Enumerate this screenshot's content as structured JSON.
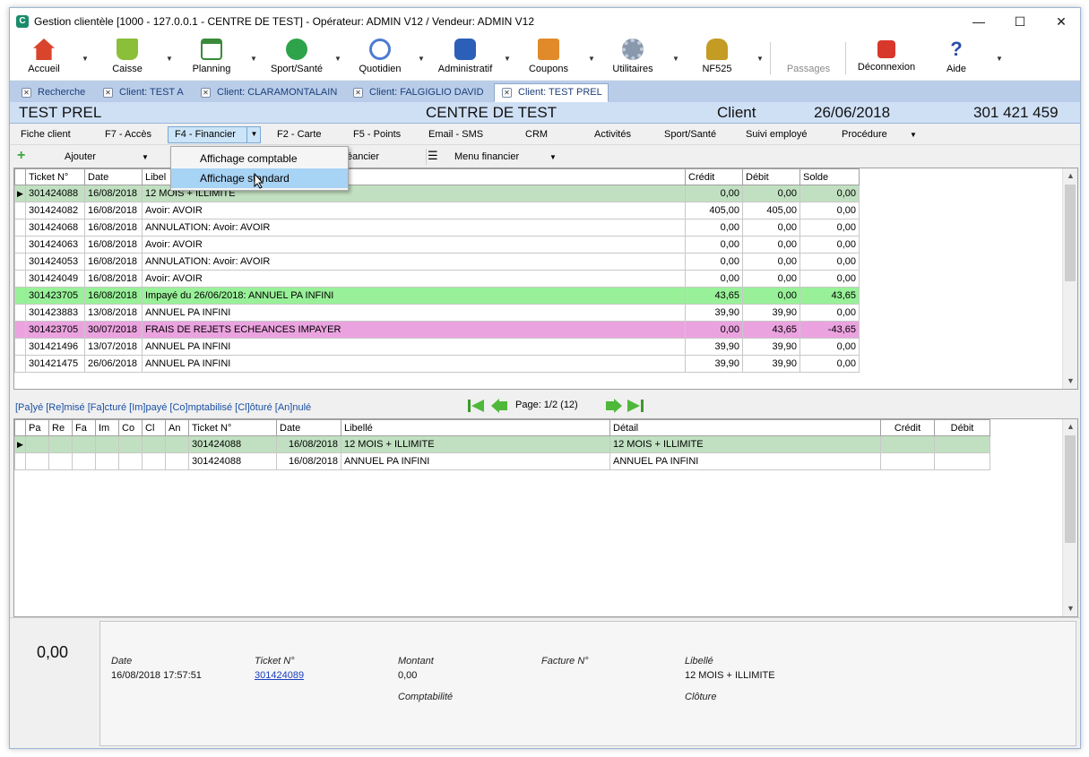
{
  "window": {
    "title": "Gestion clientèle [1000 - 127.0.0.1 - CENTRE DE TEST] - Opérateur: ADMIN V12 / Vendeur: ADMIN V12",
    "app_icon_letter": "C",
    "controls": {
      "minimize": "—",
      "maximize": "☐",
      "close": "✕"
    }
  },
  "toolbar": [
    {
      "label": "Accueil",
      "icon": "home-icon",
      "color": "#d9452c"
    },
    {
      "label": "Caisse",
      "icon": "cart-icon",
      "color": "#8bbf3a"
    },
    {
      "label": "Planning",
      "icon": "calendar-icon",
      "color": "#3a8a3a"
    },
    {
      "label": "Sport/Santé",
      "icon": "runner-icon",
      "color": "#2ea34a"
    },
    {
      "label": "Quotidien",
      "icon": "clock-icon",
      "color": "#4d7bd1"
    },
    {
      "label": "Administratif",
      "icon": "euro-icon",
      "color": "#2b5fb8"
    },
    {
      "label": "Coupons",
      "icon": "coupon-icon",
      "color": "#e08a2a"
    },
    {
      "label": "Utilitaires",
      "icon": "gear-icon",
      "color": "#8a98ad"
    },
    {
      "label": "NF525",
      "icon": "lock-icon",
      "color": "#c49b23"
    },
    {
      "label": "Passages",
      "icon": "",
      "color": ""
    },
    {
      "label": "Déconnexion",
      "icon": "power-icon",
      "color": "#d8382c"
    },
    {
      "label": "Aide",
      "icon": "help-icon",
      "color": "#2b4fa8"
    }
  ],
  "doc_tabs": [
    {
      "label": "Recherche"
    },
    {
      "label": "Client: TEST A"
    },
    {
      "label": "Client: CLARAMONTALAIN"
    },
    {
      "label": "Client: FALGIGLIO DAVID"
    },
    {
      "label": "Client: TEST PREL"
    }
  ],
  "client_header": {
    "name": "TEST PREL",
    "centre": "CENTRE DE TEST",
    "type": "Client",
    "date": "26/06/2018",
    "number": "301 421 459"
  },
  "subnav": [
    "Fiche client",
    "F7 - Accès",
    "F4 - Financier",
    "F2 - Carte",
    "F5 - Points",
    "Email - SMS",
    "CRM",
    "Activités",
    "Sport/Santé",
    "Suivi employé",
    "Procédure"
  ],
  "actions": {
    "add": "Ajouter",
    "echeancier": "éancier",
    "menu": "Menu financier"
  },
  "dropdown": {
    "items": [
      "Affichage comptable",
      "Affichage standard"
    ]
  },
  "grid1": {
    "columns": [
      "Ticket N°",
      "Date",
      "Libel",
      "Crédit",
      "Débit",
      "Solde"
    ],
    "rows": [
      {
        "ticket": "301424088",
        "date": "16/08/2018",
        "libelle": "12 MOIS + ILLIMITE",
        "credit": "0,00",
        "debit": "0,00",
        "solde": "0,00",
        "style": "green-sel",
        "ind": "▶"
      },
      {
        "ticket": "301424082",
        "date": "16/08/2018",
        "libelle": "Avoir: AVOIR",
        "credit": "405,00",
        "debit": "405,00",
        "solde": "0,00",
        "style": "",
        "ind": ""
      },
      {
        "ticket": "301424068",
        "date": "16/08/2018",
        "libelle": "ANNULATION: Avoir: AVOIR",
        "credit": "0,00",
        "debit": "0,00",
        "solde": "0,00",
        "style": "",
        "ind": ""
      },
      {
        "ticket": "301424063",
        "date": "16/08/2018",
        "libelle": "Avoir: AVOIR",
        "credit": "0,00",
        "debit": "0,00",
        "solde": "0,00",
        "style": "",
        "ind": ""
      },
      {
        "ticket": "301424053",
        "date": "16/08/2018",
        "libelle": "ANNULATION: Avoir: AVOIR",
        "credit": "0,00",
        "debit": "0,00",
        "solde": "0,00",
        "style": "",
        "ind": ""
      },
      {
        "ticket": "301424049",
        "date": "16/08/2018",
        "libelle": "Avoir: AVOIR",
        "credit": "0,00",
        "debit": "0,00",
        "solde": "0,00",
        "style": "",
        "ind": ""
      },
      {
        "ticket": "301423705",
        "date": "16/08/2018",
        "libelle": "Impayé du 26/06/2018: ANNUEL PA INFINI",
        "credit": "43,65",
        "debit": "0,00",
        "solde": "43,65",
        "style": "green",
        "ind": ""
      },
      {
        "ticket": "301423883",
        "date": "13/08/2018",
        "libelle": "ANNUEL PA INFINI",
        "credit": "39,90",
        "debit": "39,90",
        "solde": "0,00",
        "style": "",
        "ind": ""
      },
      {
        "ticket": "301423705",
        "date": "30/07/2018",
        "libelle": "FRAIS DE REJETS ECHEANCES IMPAYER",
        "credit": "0,00",
        "debit": "43,65",
        "solde": "-43,65",
        "style": "pink",
        "ind": ""
      },
      {
        "ticket": "301421496",
        "date": "13/07/2018",
        "libelle": "ANNUEL PA INFINI",
        "credit": "39,90",
        "debit": "39,90",
        "solde": "0,00",
        "style": "",
        "ind": ""
      },
      {
        "ticket": "301421475",
        "date": "26/06/2018",
        "libelle": "ANNUEL PA INFINI",
        "credit": "39,90",
        "debit": "39,90",
        "solde": "0,00",
        "style": "",
        "ind": ""
      }
    ]
  },
  "legend": "[Pa]yé [Re]misé [Fa]cturé [Im]payé [Co]mptabilisé [Cl]ôturé [An]nulé",
  "pager": {
    "text": "Page: 1/2 (12)"
  },
  "grid2": {
    "columns": [
      "Pa",
      "Re",
      "Fa",
      "Im",
      "Co",
      "Cl",
      "An",
      "Ticket N°",
      "Date",
      "Libellé",
      "Détail",
      "Crédit",
      "Débit"
    ],
    "rows": [
      {
        "ticket": "301424088",
        "date": "16/08/2018",
        "libelle": "12 MOIS + ILLIMITE",
        "detail": "12 MOIS + ILLIMITE",
        "credit": "",
        "debit": "",
        "style": "green-sel",
        "ind": "▶"
      },
      {
        "ticket": "301424088",
        "date": "16/08/2018",
        "libelle": "ANNUEL PA INFINI",
        "detail": "ANNUEL PA INFINI",
        "credit": "",
        "debit": "",
        "style": "",
        "ind": ""
      }
    ]
  },
  "summary": {
    "amount": "0,00",
    "date_label": "Date",
    "date": "16/08/2018 17:57:51",
    "ticket_label": "Ticket N°",
    "ticket": "301424089",
    "montant_label": "Montant",
    "montant": "0,00",
    "facture_label": "Facture N°",
    "libelle_label": "Libellé",
    "libelle": "12 MOIS + ILLIMITE",
    "comptabilite_label": "Comptabilité",
    "cloture_label": "Clôture"
  }
}
